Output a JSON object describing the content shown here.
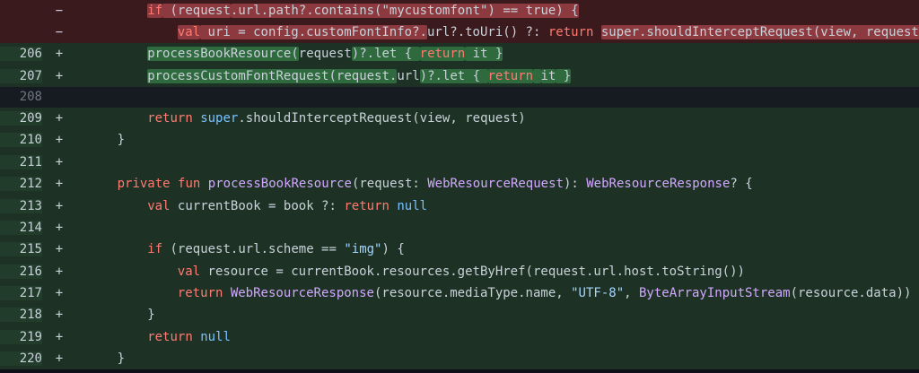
{
  "diff": {
    "lines": [
      {
        "num": "",
        "sign": "−",
        "type": "del",
        "indent": 2,
        "tokens": [
          {
            "t": "if",
            "c": "kw",
            "h": true
          },
          {
            "t": " (request",
            "c": "plain",
            "h": true
          },
          {
            "t": ".url.path?.contains(\"mycustomfont\") == true) {",
            "c": "plain",
            "h": true
          }
        ]
      },
      {
        "num": "",
        "sign": "−",
        "type": "del",
        "indent": 3,
        "tokens": [
          {
            "t": "val",
            "c": "kw",
            "h": true
          },
          {
            "t": " uri = config.customFontInfo?.",
            "c": "plain",
            "h": true
          },
          {
            "t": "url",
            "c": "plain",
            "h": false
          },
          {
            "t": "?.toUri() ?: ",
            "c": "plain",
            "h": false
          },
          {
            "t": "return",
            "c": "kw",
            "h": false
          },
          {
            "t": " ",
            "c": "plain",
            "h": false
          },
          {
            "t": "super.shouldInterceptRequest(view, request)",
            "c": "plain",
            "h": true
          }
        ]
      },
      {
        "num": "206",
        "sign": "+",
        "type": "add",
        "indent": 2,
        "tokens": [
          {
            "t": "processBookResource(",
            "c": "plain",
            "h": true
          },
          {
            "t": "request",
            "c": "plain",
            "h": false
          },
          {
            "t": ")?.let { ",
            "c": "plain",
            "h": true
          },
          {
            "t": "return",
            "c": "kw",
            "h": true
          },
          {
            "t": " it }",
            "c": "plain",
            "h": true
          }
        ]
      },
      {
        "num": "207",
        "sign": "+",
        "type": "add",
        "indent": 2,
        "tokens": [
          {
            "t": "processCustomFontRequest(request.",
            "c": "plain",
            "h": true
          },
          {
            "t": "url",
            "c": "plain",
            "h": false
          },
          {
            "t": ")?.let { ",
            "c": "plain",
            "h": true
          },
          {
            "t": "return",
            "c": "kw",
            "h": true
          },
          {
            "t": " ",
            "c": "plain",
            "h": true
          },
          {
            "t": "it",
            "c": "plain",
            "h": true
          },
          {
            "t": " }",
            "c": "plain",
            "h": true
          }
        ]
      },
      {
        "num": "208",
        "sign": "",
        "type": "empty",
        "indent": 0,
        "tokens": []
      },
      {
        "num": "209",
        "sign": "+",
        "type": "add",
        "indent": 2,
        "tokens": [
          {
            "t": "return",
            "c": "kw"
          },
          {
            "t": " ",
            "c": "plain"
          },
          {
            "t": "super",
            "c": "lit"
          },
          {
            "t": ".shouldInterceptRequest(view, request)",
            "c": "plain"
          }
        ]
      },
      {
        "num": "210",
        "sign": "+",
        "type": "add",
        "indent": 1,
        "tokens": [
          {
            "t": "}",
            "c": "plain"
          }
        ]
      },
      {
        "num": "211",
        "sign": "+",
        "type": "add",
        "indent": 0,
        "tokens": []
      },
      {
        "num": "212",
        "sign": "+",
        "type": "add",
        "indent": 1,
        "tokens": [
          {
            "t": "private",
            "c": "kw"
          },
          {
            "t": " ",
            "c": "plain"
          },
          {
            "t": "fun",
            "c": "kw"
          },
          {
            "t": " ",
            "c": "plain"
          },
          {
            "t": "processBookResource",
            "c": "fn"
          },
          {
            "t": "(request: ",
            "c": "plain"
          },
          {
            "t": "WebResourceRequest",
            "c": "ty"
          },
          {
            "t": "): ",
            "c": "plain"
          },
          {
            "t": "WebResourceResponse",
            "c": "ty"
          },
          {
            "t": "? {",
            "c": "plain"
          }
        ]
      },
      {
        "num": "213",
        "sign": "+",
        "type": "add",
        "indent": 2,
        "tokens": [
          {
            "t": "val",
            "c": "kw"
          },
          {
            "t": " currentBook = book ?: ",
            "c": "plain"
          },
          {
            "t": "return",
            "c": "kw"
          },
          {
            "t": " ",
            "c": "plain"
          },
          {
            "t": "null",
            "c": "lit"
          }
        ]
      },
      {
        "num": "214",
        "sign": "+",
        "type": "add",
        "indent": 0,
        "tokens": []
      },
      {
        "num": "215",
        "sign": "+",
        "type": "add",
        "indent": 2,
        "tokens": [
          {
            "t": "if",
            "c": "kw"
          },
          {
            "t": " (request.url.scheme == ",
            "c": "plain"
          },
          {
            "t": "\"img\"",
            "c": "str"
          },
          {
            "t": ") {",
            "c": "plain"
          }
        ]
      },
      {
        "num": "216",
        "sign": "+",
        "type": "add",
        "indent": 3,
        "tokens": [
          {
            "t": "val",
            "c": "kw"
          },
          {
            "t": " resource = currentBook.resources.getByHref(request.url.host.toString())",
            "c": "plain"
          }
        ]
      },
      {
        "num": "217",
        "sign": "+",
        "type": "add",
        "indent": 3,
        "tokens": [
          {
            "t": "return",
            "c": "kw"
          },
          {
            "t": " ",
            "c": "plain"
          },
          {
            "t": "WebResourceResponse",
            "c": "ty"
          },
          {
            "t": "(resource.mediaType.name, ",
            "c": "plain"
          },
          {
            "t": "\"UTF-8\"",
            "c": "str"
          },
          {
            "t": ", ",
            "c": "plain"
          },
          {
            "t": "ByteArrayInputStream",
            "c": "ty"
          },
          {
            "t": "(resource.data))",
            "c": "plain"
          }
        ]
      },
      {
        "num": "218",
        "sign": "+",
        "type": "add",
        "indent": 2,
        "tokens": [
          {
            "t": "}",
            "c": "plain"
          }
        ]
      },
      {
        "num": "219",
        "sign": "+",
        "type": "add",
        "indent": 2,
        "tokens": [
          {
            "t": "return",
            "c": "kw"
          },
          {
            "t": " ",
            "c": "plain"
          },
          {
            "t": "null",
            "c": "lit"
          }
        ]
      },
      {
        "num": "220",
        "sign": "+",
        "type": "add",
        "indent": 1,
        "tokens": [
          {
            "t": "}",
            "c": "plain"
          }
        ]
      }
    ]
  }
}
